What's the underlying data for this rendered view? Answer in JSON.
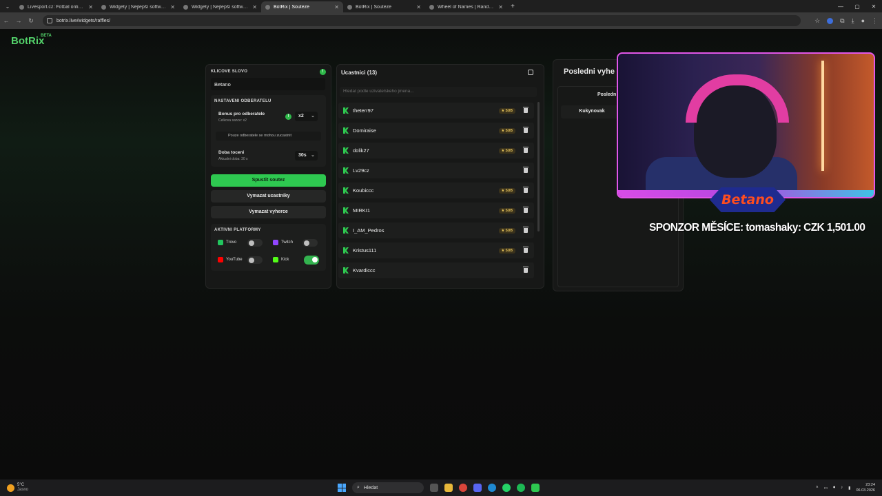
{
  "browser": {
    "tabs": [
      {
        "title": "Livesport.cz: Fotbal online, fotb",
        "active": false
      },
      {
        "title": "Widgety | Nejlepší software pr",
        "active": false
      },
      {
        "title": "Widgety | Nejlepší software pr",
        "active": false
      },
      {
        "title": "BotRix | Souteze",
        "active": true
      },
      {
        "title": "BotRix | Souteze",
        "active": false
      },
      {
        "title": "Wheel of Names | Random nam",
        "active": false
      }
    ],
    "url": "botrix.live/widgets/raffles/"
  },
  "logo": {
    "text": "BotRix",
    "badge": "BETA"
  },
  "settings": {
    "keyword_label": "KLICOVE SLOVO",
    "keyword_value": "Betano",
    "subscribers_section": "NASTAVENI ODBERATELU",
    "bonus_title": "Bonus pro odberatele",
    "bonus_sub": "Celkova sance: x2",
    "bonus_value": "x2",
    "only_subs_label": "Pouze odberatele se mohou zucastnit",
    "spin_title": "Doba toceni",
    "spin_sub": "Aktualni doba: 30 s",
    "spin_value": "30s",
    "start_button": "Spustit soutez",
    "clear_participants_button": "Vymazat ucastniky",
    "clear_winners_button": "Vymazat vyherce",
    "platforms_section": "AKTIVNI PLATFORMY",
    "platforms": [
      {
        "name": "Trovo",
        "on": false,
        "color": "#22c55e"
      },
      {
        "name": "Twitch",
        "on": false,
        "color": "#9146ff"
      },
      {
        "name": "YouTube",
        "on": false,
        "color": "#ff0000"
      },
      {
        "name": "Kick",
        "on": true,
        "color": "#53fc18"
      }
    ]
  },
  "participants": {
    "title": "Ucastnici (13)",
    "search_placeholder": "Hledat podle uzivatelskeho jmena...",
    "sub_badge": "SUB",
    "rows": [
      {
        "name": "theterr97",
        "sub": true
      },
      {
        "name": "Domiraise",
        "sub": true
      },
      {
        "name": "dolik27",
        "sub": true
      },
      {
        "name": "Lv29cz",
        "sub": false
      },
      {
        "name": "Koubiccc",
        "sub": true
      },
      {
        "name": "MIRKI1",
        "sub": true
      },
      {
        "name": "I_AM_Pedros",
        "sub": true
      },
      {
        "name": "Kristus111",
        "sub": true
      },
      {
        "name": "Kvardiccc",
        "sub": false
      }
    ]
  },
  "winners": {
    "title": "Posledni vyhe",
    "column_header": "Posledn",
    "entries": [
      "Kukynovak"
    ]
  },
  "stream_overlay": {
    "brand": "Betano",
    "sponsor_text": "SPONZOR MĚSÍCE: tomashaky: CZK 1,501.00"
  },
  "taskbar": {
    "temp": "5°C",
    "weather": "Jasno",
    "search": "Hledat",
    "time": "23:24",
    "date": "06.03.2026"
  }
}
